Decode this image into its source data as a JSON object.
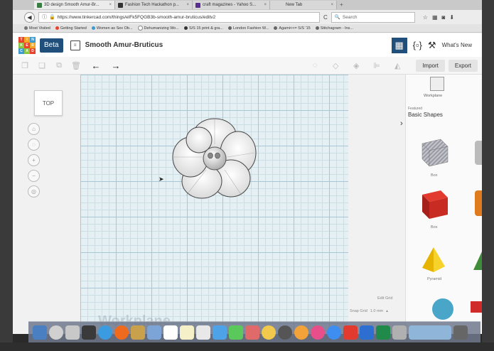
{
  "browser": {
    "tabs": [
      {
        "label": "3D design Smooth Amur-Br...",
        "color": "#3a7d44",
        "active": true
      },
      {
        "label": "Fashion Tech Hackathon p...",
        "color": "#333333",
        "active": false
      },
      {
        "label": "craft magazines - Yahoo S...",
        "color": "#5a2d91",
        "active": false
      },
      {
        "label": "New Tab",
        "color": "#bbbbbb",
        "active": false
      }
    ],
    "url": "https://www.tinkercad.com/things/elFk5FQGB3b-smooth-amur-bruticus/editv2",
    "search_placeholder": "Search",
    "bookmarks": [
      "Most Visited",
      "Getting Started",
      "Women as Sex Ob...",
      "Dehumanizing Wo...",
      "S/S 15 print & gra...",
      "London Fashion W...",
      "Agami<<= S/S '15",
      "Stitchagram - Ins..."
    ]
  },
  "app": {
    "logo_letters": [
      "T",
      "I",
      "N",
      "K",
      "E",
      "R",
      "C",
      "A",
      "D"
    ],
    "logo_colors": [
      "#e8412c",
      "#f5a623",
      "#3d9ad1",
      "#8cc63f",
      "#e8412c",
      "#f5a623",
      "#3d9ad1",
      "#8cc63f",
      "#e8412c"
    ],
    "beta_label": "Beta",
    "design_title": "Smooth Amur-Bruticus",
    "whats_new": "What's New",
    "import_label": "Import",
    "export_label": "Export",
    "accent": "#1f4f7a"
  },
  "canvas": {
    "viewcube_label": "TOP",
    "workplane_label": "Workplane",
    "edit_grid": "Edit Grid",
    "snap_grid": "Snap Grid",
    "snap_value": "1.0 mm",
    "grid_color": "#e4f0f4"
  },
  "panel": {
    "workplane_label": "Workplane",
    "featured_label": "Featured",
    "category_title": "Basic Shapes",
    "shapes": [
      {
        "name": "Box",
        "icon": "box-striped-icon"
      },
      {
        "name": "Box",
        "icon": "box-red-icon"
      },
      {
        "name": "Pyramid",
        "icon": "pyramid-icon"
      }
    ]
  }
}
